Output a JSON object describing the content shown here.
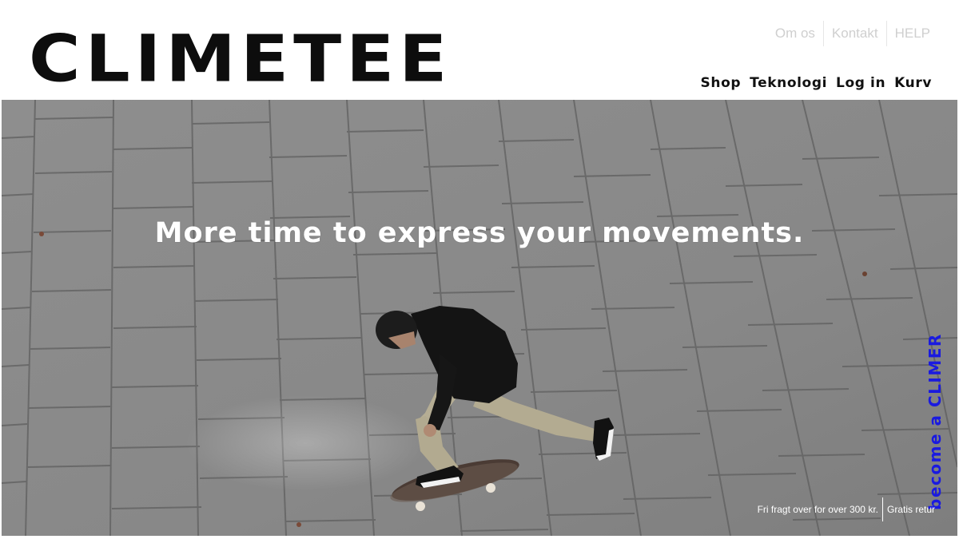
{
  "brand": {
    "logo_text": "CLIMETEE"
  },
  "utility_nav": {
    "items": [
      "Om os",
      "Kontakt",
      "HELP"
    ]
  },
  "main_nav": {
    "items": [
      "Shop",
      "Teknologi",
      "Log in",
      "Kurv"
    ]
  },
  "hero": {
    "headline": "More time to express your movements.",
    "side_cta": "become a CLIMER",
    "image_alt_icon": "skateboarder-photo"
  },
  "shipping": {
    "free_shipping": "Fri fragt over for over 300 kr.",
    "free_returns": "Gratis retur"
  },
  "colors": {
    "cta": "#1a1ae0",
    "logo": "#0d0d0d",
    "utility_text": "#cfcfcf",
    "pavement": "#8a8a8a"
  }
}
